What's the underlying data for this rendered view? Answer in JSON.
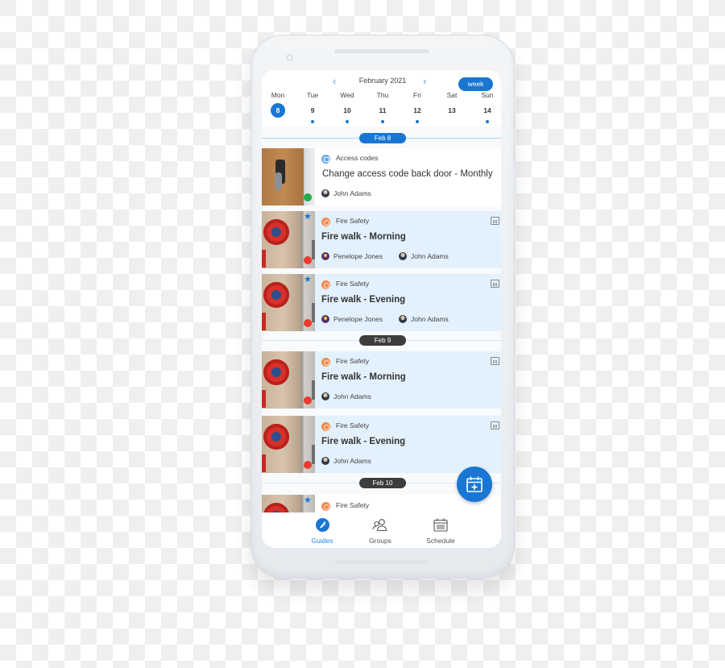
{
  "calendar": {
    "month_label": "February 2021",
    "prev_icon": "chevron-left-icon",
    "next_icon": "chevron-right-icon",
    "view_button": "week",
    "days": [
      {
        "name": "Mon",
        "num": "8",
        "selected": true,
        "has_events": false
      },
      {
        "name": "Tue",
        "num": "9",
        "selected": false,
        "has_events": true
      },
      {
        "name": "Wed",
        "num": "10",
        "selected": false,
        "has_events": true
      },
      {
        "name": "Thu",
        "num": "11",
        "selected": false,
        "has_events": true
      },
      {
        "name": "Fri",
        "num": "12",
        "selected": false,
        "has_events": true
      },
      {
        "name": "Sat",
        "num": "13",
        "selected": false,
        "has_events": false
      },
      {
        "name": "Sun",
        "num": "14",
        "selected": false,
        "has_events": true
      }
    ]
  },
  "sections": [
    {
      "date_label": "Feb 8",
      "items": [
        {
          "category": "Access codes",
          "title": "Change access code back door - Monthly",
          "assignees": [
            "John Adams"
          ],
          "status": "green",
          "starred": false,
          "scheduled": false
        },
        {
          "category": "Fire Safety",
          "title": "Fire walk - Morning",
          "assignees": [
            "Penelope Jones",
            "John Adams"
          ],
          "status": "red",
          "starred": true,
          "scheduled": true
        },
        {
          "category": "Fire Safety",
          "title": "Fire walk - Evening",
          "assignees": [
            "Penelope Jones",
            "John Adams"
          ],
          "status": "red",
          "starred": true,
          "scheduled": true
        }
      ]
    },
    {
      "date_label": "Feb 9",
      "items": [
        {
          "category": "Fire Safety",
          "title": "Fire walk - Morning",
          "assignees": [
            "John Adams"
          ],
          "status": "red",
          "starred": false,
          "scheduled": true
        },
        {
          "category": "Fire Safety",
          "title": "Fire walk - Evening",
          "assignees": [
            "John Adams"
          ],
          "status": "red",
          "starred": false,
          "scheduled": true
        }
      ]
    },
    {
      "date_label": "Feb 10",
      "items": [
        {
          "category": "Fire Safety",
          "title": "",
          "assignees": [],
          "status": "",
          "starred": true,
          "scheduled": false
        }
      ]
    }
  ],
  "fab": {
    "icon": "calendar-plus-icon"
  },
  "tabbar": {
    "tabs": [
      {
        "label": "Guides",
        "icon": "feather-icon",
        "active": true
      },
      {
        "label": "Groups",
        "icon": "people-icon",
        "active": false
      },
      {
        "label": "Schedule",
        "icon": "calendar-icon",
        "active": false
      }
    ]
  },
  "colors": {
    "accent": "#1976d2",
    "card_highlight": "#e3f1fd",
    "status_green": "#1fae4b",
    "status_red": "#ea3b2f",
    "fire_category": "#f58a4b",
    "access_category": "#6aa6e8"
  }
}
